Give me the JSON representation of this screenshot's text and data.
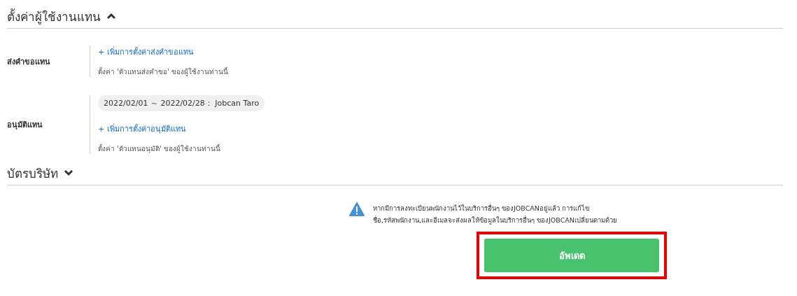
{
  "sections": [
    {
      "title": "ตั้งค่าผู้ใช้งานแทน",
      "expanded": true,
      "rows": [
        {
          "label": "ส่งคำขอแทน",
          "entries": [],
          "link": "+ เพิ่มการตั้งค่าส่งคำขอแทน",
          "note": "ตั้งค่า 'ตัวแทนส่งคำขอ' ของผู้ใช้งานท่านนี้"
        },
        {
          "label": "อนุมัติแทน",
          "entries": [
            "2022/02/01 ～ 2022/02/28： Jobcan Taro"
          ],
          "link": "+ เพิ่มการตั้งค่าอนุมัติแทน",
          "note": "ตั้งค่า 'ตัวแทนอนุมัติ' ของผู้ใช้งานท่านนี้"
        }
      ]
    },
    {
      "title": "บัตรบริษัท",
      "expanded": false
    }
  ],
  "warning": {
    "lines": [
      "หากมีการลงทะเบียนพนักงานไว้ในบริการอื่นๆ ของJOBCANอยู่แล้ว การแก้ไข",
      "ชื่อ,รหัสพนักงาน,และอีเมลจะส่งผลให้ข้อมูลในบริการอื่นๆ ของJOBCANเปลี่ยนตามด้วย"
    ]
  },
  "update_button": {
    "label": "อัพเดต",
    "highlighted": true
  }
}
